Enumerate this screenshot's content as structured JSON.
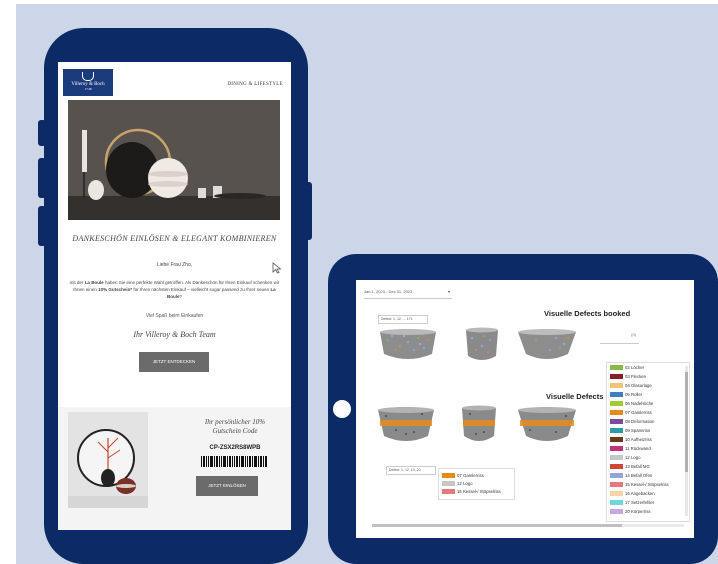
{
  "phone_email": {
    "brand_logo_text": "Villeroy & Boch",
    "brand_logo_subtext": "1748",
    "header_tagline": "DINING & LIFESTYLE",
    "headline": "DANKESCHÖN EINLÖSEN & ELEGANT KOMBINIEREN",
    "greeting": "Liebe Frau Zho,",
    "body_part1": "mit der ",
    "body_product1": "La Boule",
    "body_part2": " haben Sie eine perfekte Wahl getroffen. Als Dankeschön für Ihren Einkauf schenken wir Ihnen einen ",
    "body_discount": "10% Gutschein*",
    "body_part3": " für Ihren nächsten Einkauf – vielleicht sogar passend zu Ihrer neuen ",
    "body_product2": "La Boule",
    "body_part4": "?",
    "closing": "Viel Spaß beim Einkaufen",
    "signature": "Ihr Villeroy & Boch Team",
    "cta_button": "JETZT ENTDECKEN",
    "coupon_title": "Ihr persönlicher 10% Gutschein Code",
    "coupon_code": "CP-ZSX2RS8WPB",
    "coupon_button": "JETZT EINLÖSEN"
  },
  "tablet_dashboard": {
    "date_range": "Jan 1, 2023 - Dec 31, 2023",
    "filter_top": "Defect: 1, 12, ... 171",
    "title_booked": "Visuelle Defects booked",
    "title_second": "Visuelle Defects",
    "dropdown_value": "(0)",
    "filter_bottom": "Defect: 1, 12, 13, 20",
    "legend": [
      {
        "label": "02 Löcher",
        "color": "#8bb84a"
      },
      {
        "label": "03 Flecken",
        "color": "#8a1d2c"
      },
      {
        "label": "04 Glasurlage",
        "color": "#f2c37a"
      },
      {
        "label": "05 Roller",
        "color": "#3e7ec4"
      },
      {
        "label": "06 Nadelstiche",
        "color": "#a3c93a"
      },
      {
        "label": "07 Gamlerriss",
        "color": "#e78a1e"
      },
      {
        "label": "08 Deformation",
        "color": "#7b4c9f"
      },
      {
        "label": "09 Spannriss",
        "color": "#2f9aa8"
      },
      {
        "label": "10 Aufheizriss",
        "color": "#6a3b16"
      },
      {
        "label": "11 Rückwand",
        "color": "#c2337a"
      },
      {
        "label": "12 Logo",
        "color": "#c7c7c7"
      },
      {
        "label": "13 Befall MG",
        "color": "#d04535"
      },
      {
        "label": "14 Befall Ofen",
        "color": "#8fa6d9"
      },
      {
        "label": "15 Kessel-/ Stöpselriss",
        "color": "#e67a7a"
      },
      {
        "label": "16 Angebacken",
        "color": "#f7d3a8"
      },
      {
        "label": "17 Setzerfehler",
        "color": "#6fd6e0"
      },
      {
        "label": "20 Körperriss",
        "color": "#c9a7de"
      }
    ],
    "legend_small": [
      {
        "label": "07 Gamlerriss",
        "color": "#e78a1e"
      },
      {
        "label": "12 Logo",
        "color": "#c7c7c7"
      },
      {
        "label": "15 Kessel-/ Stöpselriss",
        "color": "#e67a7a"
      }
    ]
  }
}
